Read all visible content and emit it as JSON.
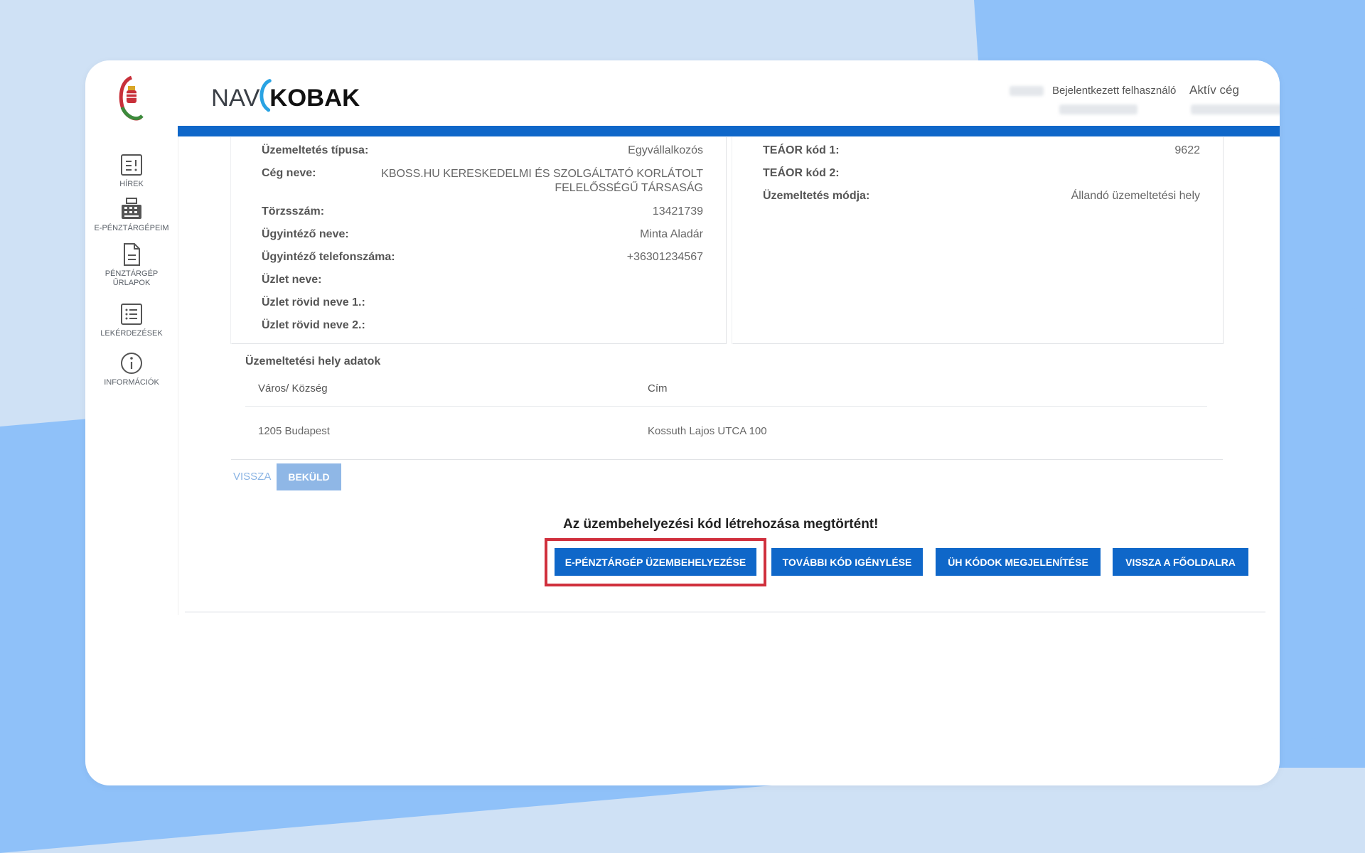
{
  "app": {
    "brand_left": "NAV",
    "brand_right": "KOBAK"
  },
  "header": {
    "logged_in_user_label": "Bejelentkezett felhasználó",
    "active_company_label": "Aktív cég",
    "language_icon": "globe-icon"
  },
  "sidebar": {
    "items": [
      {
        "label": "Hírek",
        "icon": "news-icon"
      },
      {
        "label": "E-pénztárgépeim",
        "icon": "cash-register-icon"
      },
      {
        "label": "Pénztárgép űrlapok",
        "icon": "document-icon"
      },
      {
        "label": "Lekérdezések",
        "icon": "list-icon"
      },
      {
        "label": "Információk",
        "icon": "info-icon"
      }
    ]
  },
  "details_left": [
    {
      "key": "Üzemeltetés típusa:",
      "value": "Egyvállalkozós"
    },
    {
      "key": "Cég neve:",
      "value": "KBOSS.HU KERESKEDELMI ÉS SZOLGÁLTATÓ KORLÁTOLT FELELŐSSÉGŰ TÁRSASÁG"
    },
    {
      "key": "Törzsszám:",
      "value": "13421739"
    },
    {
      "key": "Ügyintéző neve:",
      "value": "Minta Aladár"
    },
    {
      "key": "Ügyintéző telefonszáma:",
      "value": "+36301234567"
    },
    {
      "key": "Üzlet neve:",
      "value": ""
    },
    {
      "key": "Üzlet rövid neve 1.:",
      "value": ""
    },
    {
      "key": "Üzlet rövid neve 2.:",
      "value": ""
    }
  ],
  "details_right": [
    {
      "key": "TEÁOR kód 1:",
      "value": "9622"
    },
    {
      "key": "TEÁOR kód 2:",
      "value": ""
    },
    {
      "key": "Üzemeltetés módja:",
      "value": "Állandó üzemeltetési hely"
    }
  ],
  "site": {
    "title": "Üzemeltetési hely adatok",
    "columns": [
      "Város/ Község",
      "Cím"
    ],
    "rows": [
      [
        "1205 Budapest",
        "Kossuth Lajos UTCA 100"
      ]
    ]
  },
  "form_actions": {
    "back_label": "VISSZA",
    "send_label": "BEKÜLD"
  },
  "result": {
    "message": "Az üzembehelyezési kód létrehozása megtörtént!",
    "buttons": [
      "E-pénztárgép üzembehelyezése",
      "További kód igénylése",
      "ÜH kódok megjelenítése",
      "Vissza a főoldalra"
    ]
  },
  "colors": {
    "brand_blue": "#0f67c9",
    "highlight_red": "#d0303d",
    "disabled_blue": "#8fb7e6"
  }
}
